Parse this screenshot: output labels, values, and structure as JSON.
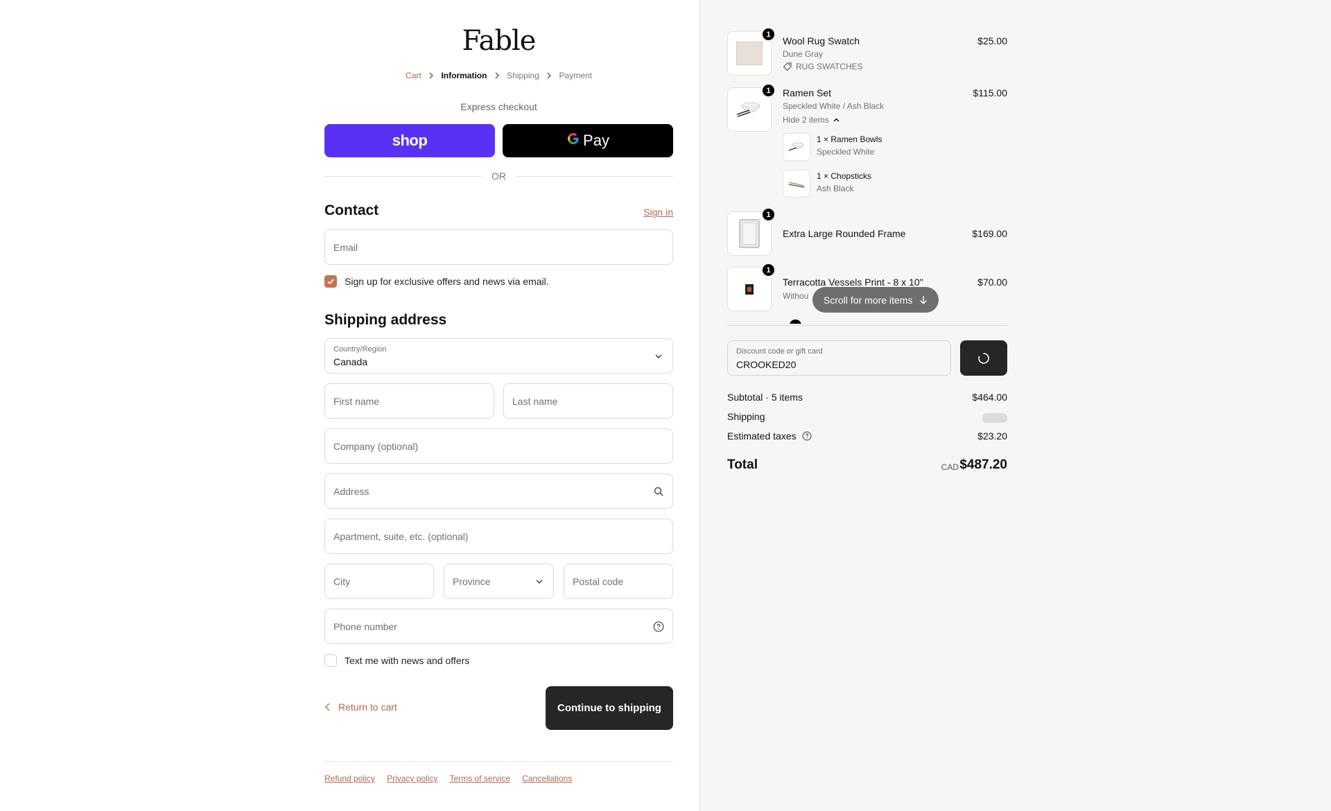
{
  "brand": {
    "name": "Fable"
  },
  "breadcrumb": [
    "Cart",
    "Information",
    "Shipping",
    "Payment"
  ],
  "express": {
    "label": "Express checkout",
    "shop_label": "shop",
    "gpay_label": "Pay",
    "or_label": "OR"
  },
  "contact": {
    "title": "Contact",
    "sign_in": "Sign in",
    "email_placeholder": "Email",
    "newsletter_label": "Sign up for exclusive offers and news via email.",
    "newsletter_checked": true
  },
  "shipping_address": {
    "title": "Shipping address",
    "country_label": "Country/Region",
    "country_value": "Canada",
    "first_name_placeholder": "First name",
    "last_name_placeholder": "Last name",
    "company_placeholder": "Company (optional)",
    "address_placeholder": "Address",
    "apartment_placeholder": "Apartment, suite, etc. (optional)",
    "city_placeholder": "City",
    "province_placeholder": "Province",
    "postal_placeholder": "Postal code",
    "phone_placeholder": "Phone number",
    "sms_label": "Text me with news and offers",
    "sms_checked": false
  },
  "actions": {
    "return_label": "Return to cart",
    "continue_label": "Continue to shipping"
  },
  "footer_links": [
    "Refund policy",
    "Privacy policy",
    "Terms of service",
    "Cancellations"
  ],
  "order": {
    "items": [
      {
        "name": "Wool Rug Swatch",
        "variant": "Dune Gray",
        "tag": "RUG SWATCHES",
        "price": "$25.00",
        "qty": "1"
      },
      {
        "name": "Ramen Set",
        "variant": "Speckled White / Ash Black",
        "toggle": "Hide 2 items",
        "price": "$115.00",
        "qty": "1",
        "components": [
          {
            "name": "1 × Ramen Bowls",
            "variant": "Speckled White"
          },
          {
            "name": "1 × Chopsticks",
            "variant": "Ash Black"
          }
        ]
      },
      {
        "name": "Extra Large Rounded Frame",
        "price": "$169.00",
        "qty": "1"
      },
      {
        "name": "Terracotta Vessels Print - 8 x 10\"",
        "variant": "Withou",
        "price": "$70.00",
        "qty": "1"
      }
    ],
    "scroll_hint": "Scroll for more items",
    "discount_label": "Discount code or gift card",
    "discount_value": "CROOKED20",
    "subtotal_label": "Subtotal · 5 items",
    "subtotal_value": "$464.00",
    "shipping_label": "Shipping",
    "taxes_label": "Estimated taxes",
    "taxes_value": "$23.20",
    "total_label": "Total",
    "currency": "CAD",
    "total_value": "$487.20"
  },
  "colors": {
    "accent": "#b0684a",
    "shop_purple": "#5a31f4",
    "checkbox": "#c87350",
    "dark_button": "#262626"
  }
}
